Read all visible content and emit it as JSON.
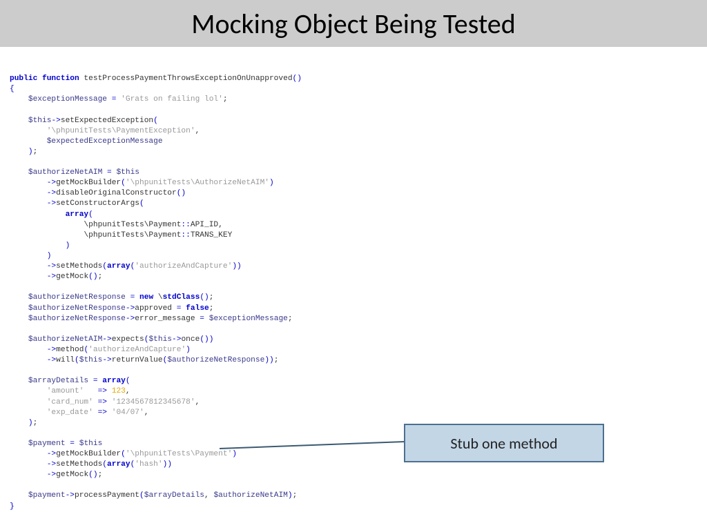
{
  "header": {
    "title": "Mocking Object Being Tested"
  },
  "callout": {
    "label": "Stub one method"
  },
  "code": {
    "l1a": "public function ",
    "l1b": "testProcessPaymentThrowsExceptionOnUnapproved",
    "l1c": "()",
    "l2": "{",
    "l3a": "$exceptionMessage",
    "l3b": " = ",
    "l3c": "'Grats on failing lol'",
    "l3d": ";",
    "l5a": "$this",
    "l5b": "->",
    "l5c": "setExpectedException",
    "l5d": "(",
    "l6a": "'\\phpunitTests\\PaymentException'",
    "l6b": ",",
    "l7a": "$expectedExceptionMessage",
    "l8a": ")",
    "l8b": ";",
    "l10a": "$authorizeNetAIM",
    "l10b": " = ",
    "l10c": "$this",
    "l11a": "->",
    "l11b": "getMockBuilder",
    "l11c": "(",
    "l11d": "'\\phpunitTests\\AuthorizeNetAIM'",
    "l11e": ")",
    "l12a": "->",
    "l12b": "disableOriginalConstructor",
    "l12c": "()",
    "l13a": "->",
    "l13b": "setConstructorArgs",
    "l13c": "(",
    "l14a": "array",
    "l14b": "(",
    "l15a": "\\phpunitTests\\Payment",
    "l15b": "::",
    "l15c": "API_ID",
    "l15d": ",",
    "l16a": "\\phpunitTests\\Payment",
    "l16b": "::",
    "l16c": "TRANS_KEY",
    "l17a": ")",
    "l18a": ")",
    "l19a": "->",
    "l19b": "setMethods",
    "l19c": "(",
    "l19d": "array",
    "l19e": "(",
    "l19f": "'authorizeAndCapture'",
    "l19g": "))",
    "l20a": "->",
    "l20b": "getMock",
    "l20c": "()",
    "l20d": ";",
    "l22a": "$authorizeNetResponse",
    "l22b": " = ",
    "l22c": "new ",
    "l22d": "\\",
    "l22e": "stdClass",
    "l22f": "()",
    "l22g": ";",
    "l23a": "$authorizeNetResponse",
    "l23b": "->",
    "l23c": "approved",
    "l23d": " = ",
    "l23e": "false",
    "l23f": ";",
    "l24a": "$authorizeNetResponse",
    "l24b": "->",
    "l24c": "error_message",
    "l24d": " = ",
    "l24e": "$exceptionMessage",
    "l24f": ";",
    "l26a": "$authorizeNetAIM",
    "l26b": "->",
    "l26c": "expects",
    "l26d": "(",
    "l26e": "$this",
    "l26f": "->",
    "l26g": "once",
    "l26h": "())",
    "l27a": "->",
    "l27b": "method",
    "l27c": "(",
    "l27d": "'authorizeAndCapture'",
    "l27e": ")",
    "l28a": "->",
    "l28b": "will",
    "l28c": "(",
    "l28d": "$this",
    "l28e": "->",
    "l28f": "returnValue",
    "l28g": "(",
    "l28h": "$authorizeNetResponse",
    "l28i": "))",
    "l28j": ";",
    "l30a": "$arrayDetails",
    "l30b": " = ",
    "l30c": "array",
    "l30d": "(",
    "l31a": "'amount'   ",
    "l31b": "=> ",
    "l31c": "123",
    "l31d": ",",
    "l32a": "'card_num' ",
    "l32b": "=> ",
    "l32c": "'1234567812345678'",
    "l32d": ",",
    "l33a": "'exp_date' ",
    "l33b": "=> ",
    "l33c": "'04/07'",
    "l33d": ",",
    "l34a": ")",
    "l34b": ";",
    "l36a": "$payment",
    "l36b": " = ",
    "l36c": "$this",
    "l37a": "->",
    "l37b": "getMockBuilder",
    "l37c": "(",
    "l37d": "'\\phpunitTests\\Payment'",
    "l37e": ")",
    "l38a": "->",
    "l38b": "setMethods",
    "l38c": "(",
    "l38d": "array",
    "l38e": "(",
    "l38f": "'hash'",
    "l38g": "))",
    "l39a": "->",
    "l39b": "getMock",
    "l39c": "()",
    "l39d": ";",
    "l41a": "$payment",
    "l41b": "->",
    "l41c": "processPayment",
    "l41d": "(",
    "l41e": "$arrayDetails",
    "l41f": ", ",
    "l41g": "$authorizeNetAIM",
    "l41h": ")",
    "l41i": ";",
    "l42": "}"
  }
}
